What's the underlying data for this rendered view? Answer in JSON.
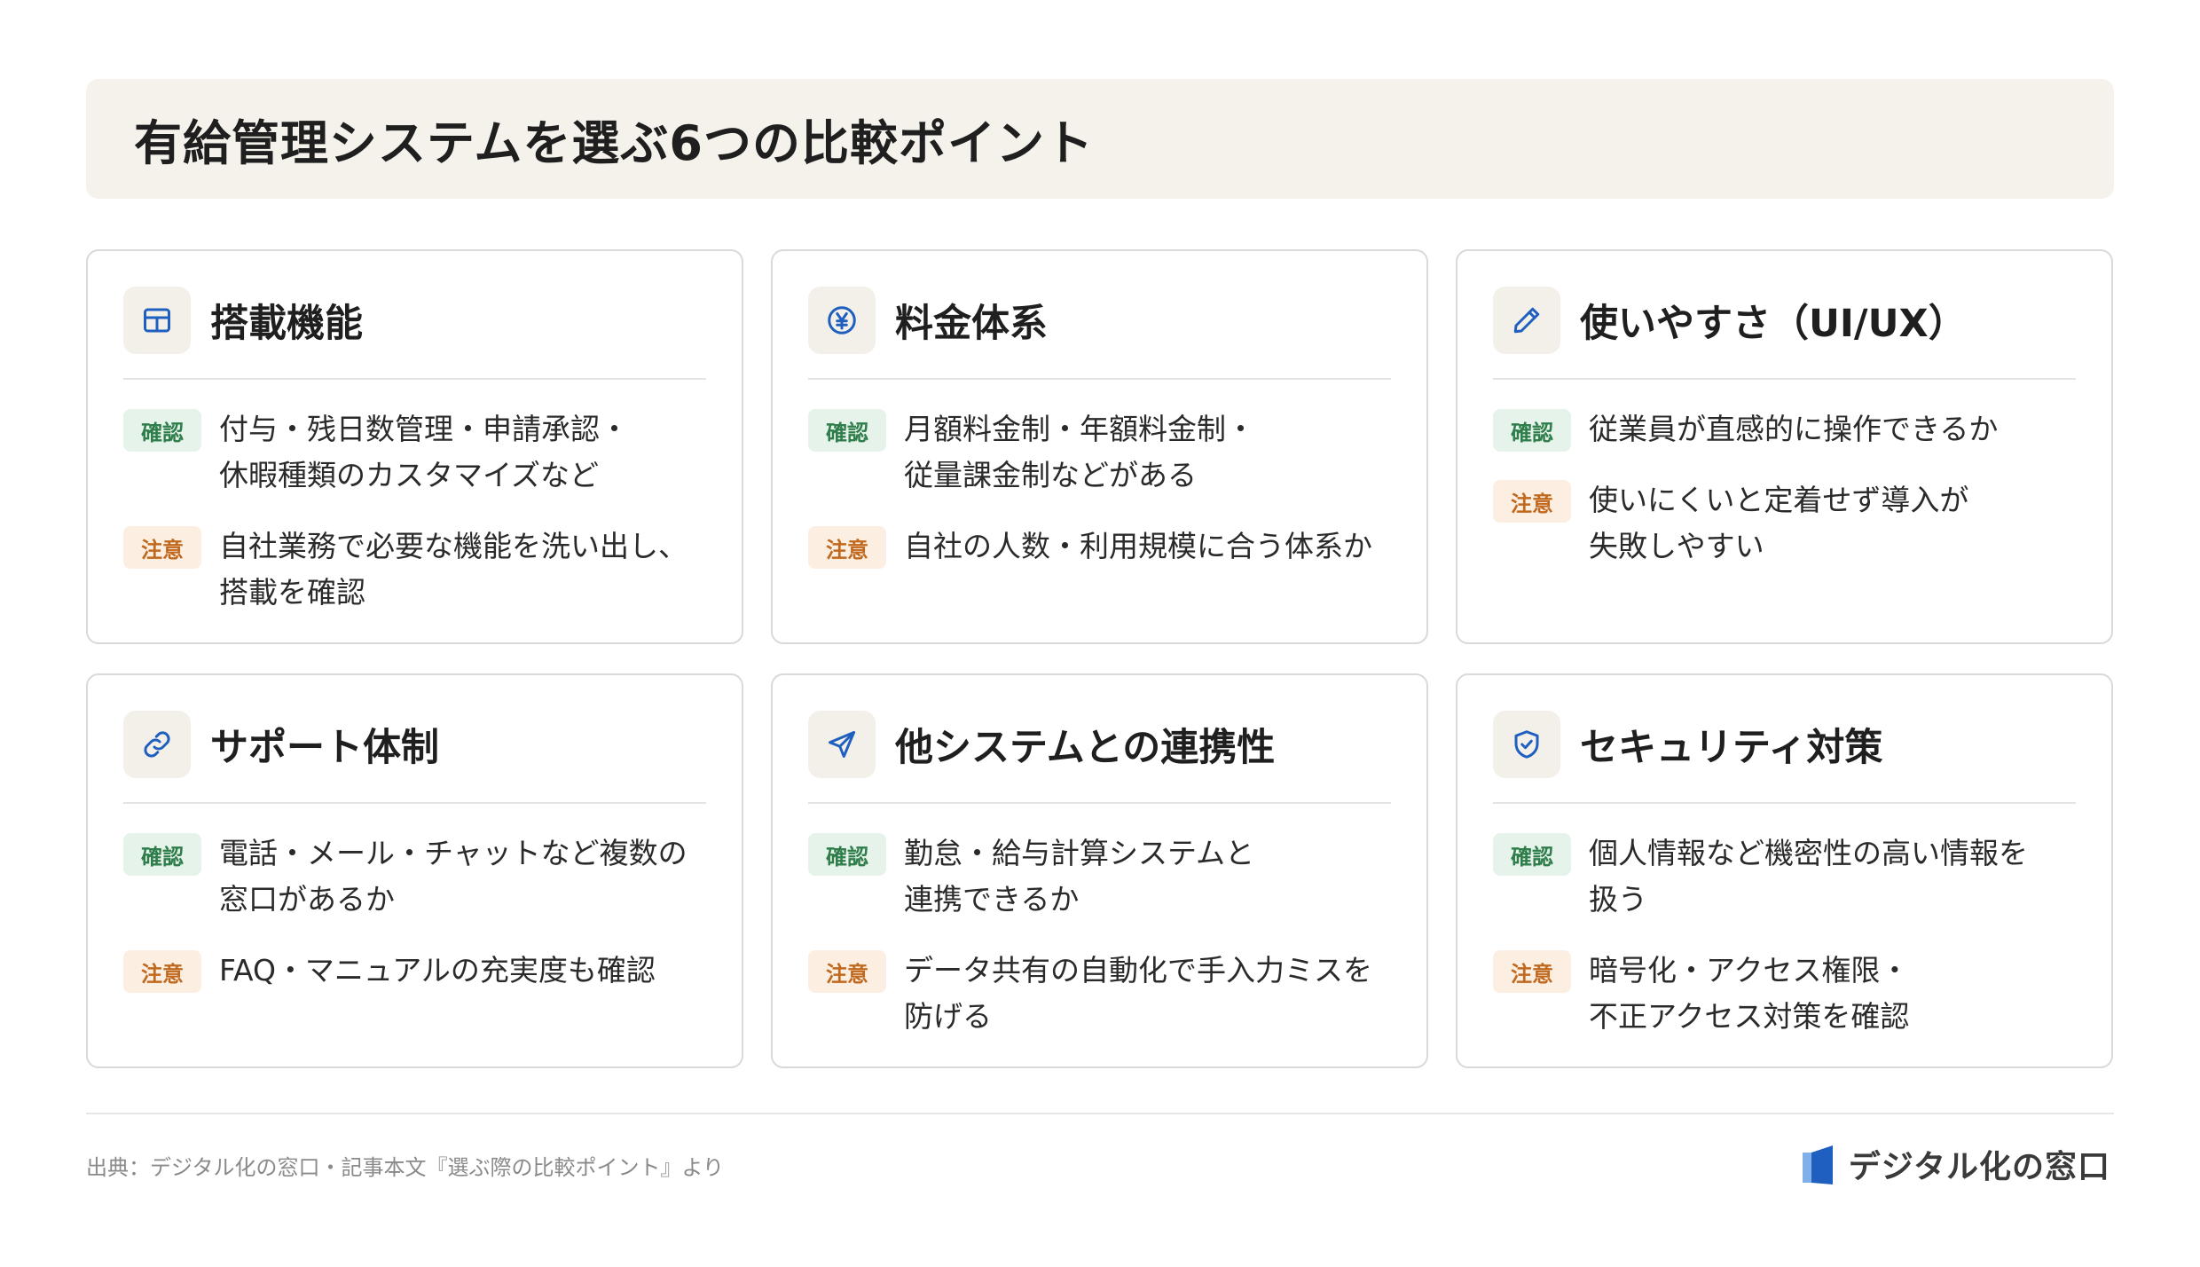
{
  "title": "有給管理システムを選ぶ6つの比較ポイント",
  "colors": {
    "accent_blue": "#1f5fbf",
    "ok_green": "#2f7d4a",
    "warn_orange": "#c0691e",
    "panel_beige": "#f5f2ec"
  },
  "cards": [
    {
      "icon": "table-icon",
      "title": "搭載機能",
      "check_badge": "確認",
      "check_text": "付与・残日数管理・申請承認・\n休暇種類のカスタマイズなど",
      "caution_badge": "注意",
      "caution_text": "自社業務で必要な機能を洗い出し、\n搭載を確認"
    },
    {
      "icon": "yen-icon",
      "title": "料金体系",
      "check_badge": "確認",
      "check_text": "月額料金制・年額料金制・\n従量課金制などがある",
      "caution_badge": "注意",
      "caution_text": "自社の人数・利用規模に合う体系か"
    },
    {
      "icon": "pencil-icon",
      "title": "使いやすさ（UI/UX）",
      "check_badge": "確認",
      "check_text": "従業員が直感的に操作できるか",
      "caution_badge": "注意",
      "caution_text": "使いにくいと定着せず導入が\n失敗しやすい"
    },
    {
      "icon": "link-icon",
      "title": "サポート体制",
      "check_badge": "確認",
      "check_text": "電話・メール・チャットなど複数の\n窓口があるか",
      "caution_badge": "注意",
      "caution_text": "FAQ・マニュアルの充実度も確認"
    },
    {
      "icon": "send-icon",
      "title": "他システムとの連携性",
      "check_badge": "確認",
      "check_text": "勤怠・給与計算システムと\n連携できるか",
      "caution_badge": "注意",
      "caution_text": "データ共有の自動化で手入力ミスを\n防げる"
    },
    {
      "icon": "shield-check-icon",
      "title": "セキュリティ対策",
      "check_badge": "確認",
      "check_text": "個人情報など機密性の高い情報を\n扱う",
      "caution_badge": "注意",
      "caution_text": "暗号化・アクセス権限・\n不正アクセス対策を確認"
    }
  ],
  "footer": {
    "source": "出典：デジタル化の窓口・記事本文『選ぶ際の比較ポイント』より",
    "brand": "デジタル化の窓口"
  }
}
